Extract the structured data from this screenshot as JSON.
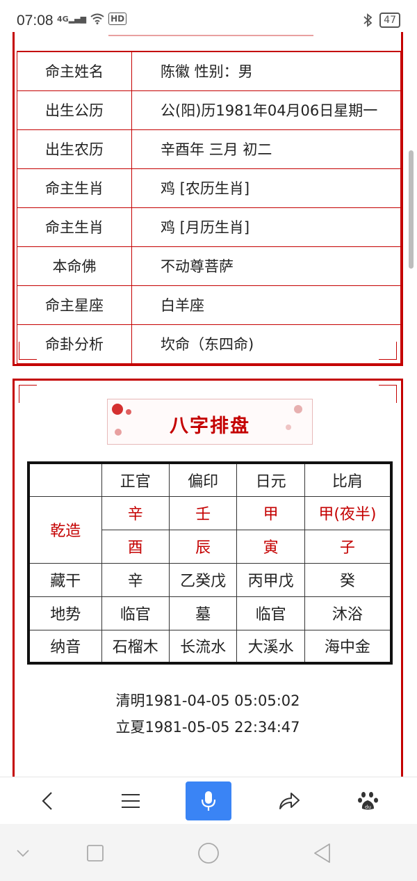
{
  "status_bar": {
    "time": "07:08",
    "network": "4G",
    "hd": "HD",
    "battery": "47"
  },
  "info_rows": [
    {
      "label": "命主姓名",
      "value": "陈徽   性别：男"
    },
    {
      "label": "出生公历",
      "value": "公(阳)历1981年04月06日星期一"
    },
    {
      "label": "出生农历",
      "value": "辛酉年 三月 初二"
    },
    {
      "label": "命主生肖",
      "value": "鸡 [农历生肖]"
    },
    {
      "label": "命主生肖",
      "value": "鸡 [月历生肖]"
    },
    {
      "label": "本命佛",
      "value": "不动尊菩萨"
    },
    {
      "label": "命主星座",
      "value": "白羊座"
    },
    {
      "label": "命卦分析",
      "value": "坎命（东四命)"
    }
  ],
  "bazi_banner": "八字排盘",
  "bazi": {
    "headers": [
      "正官",
      "偏印",
      "日元",
      "比肩"
    ],
    "qianzao_label": "乾造",
    "heavenly_stems": [
      "辛",
      "壬",
      "甲",
      "甲(夜半)"
    ],
    "earthly_branches": [
      "酉",
      "辰",
      "寅",
      "子"
    ],
    "canggan": {
      "label": "藏干",
      "values": [
        "辛",
        "乙癸戊",
        "丙甲戊",
        "癸"
      ]
    },
    "dishi": {
      "label": "地势",
      "values": [
        "临官",
        "墓",
        "临官",
        "沐浴"
      ]
    },
    "nayin": {
      "label": "纳音",
      "values": [
        "石榴木",
        "长流水",
        "大溪水",
        "海中金"
      ]
    }
  },
  "jieqi": {
    "line1": "清明1981-04-05 05:05:02",
    "line2": "立夏1981-05-05 22:34:47"
  },
  "colors": {
    "accent_red": "#c40000",
    "mic_blue": "#3a84f5"
  },
  "icons": {
    "toolbar": [
      "back-icon",
      "menu-icon",
      "microphone-icon",
      "share-icon",
      "baidu-paw-icon"
    ],
    "system_nav": [
      "collapse-icon",
      "recent-apps-icon",
      "home-icon",
      "back-triangle-icon"
    ]
  }
}
